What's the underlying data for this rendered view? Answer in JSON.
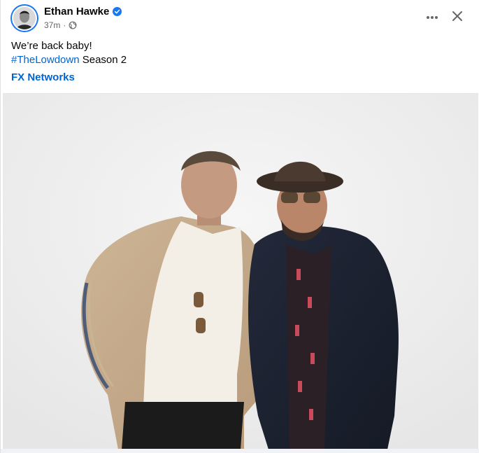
{
  "post": {
    "author": "Ethan Hawke",
    "verified": true,
    "time": "37m",
    "separator": "·",
    "privacy_icon": "globe-icon",
    "text_line1": "We’re back baby!",
    "hashtag": "#TheLowdown",
    "text_line2_rest": " Season 2",
    "mention": "FX Networks",
    "actions": {
      "more_icon": "more-horizontal-icon",
      "close_icon": "close-icon"
    }
  },
  "colors": {
    "link": "#0064d1",
    "verified": "#1877f2",
    "meta": "#65676b"
  }
}
